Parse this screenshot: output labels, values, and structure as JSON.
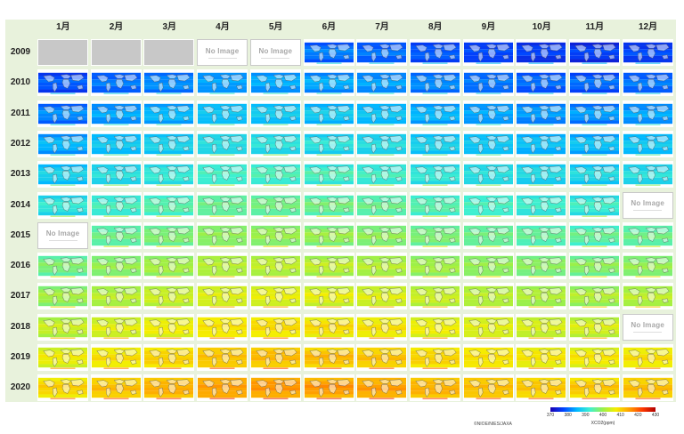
{
  "months": [
    "1月",
    "2月",
    "3月",
    "4月",
    "5月",
    "6月",
    "7月",
    "8月",
    "9月",
    "10月",
    "11月",
    "12月"
  ],
  "years": [
    "2009",
    "2010",
    "2011",
    "2012",
    "2013",
    "2014",
    "2015",
    "2016",
    "2017",
    "2018",
    "2019",
    "2020"
  ],
  "no_image_label": "No Image",
  "cells": {
    "2009-1": "nodata",
    "2009-2": "nodata",
    "2009-3": "nodata",
    "2009-4": "noimage",
    "2009-5": "noimage",
    "2014-12": "noimage",
    "2015-1": "noimage",
    "2018-12": "noimage"
  },
  "credit": "©NIOE/NIES/JAXA",
  "colorbar": {
    "ticks": [
      "370",
      "380",
      "390",
      "400",
      "410",
      "420",
      "430"
    ],
    "unit_label": "XCO2(ppm)",
    "colors": [
      "#1a00b0",
      "#0044ff",
      "#00b8ff",
      "#3ef0d0",
      "#9af04a",
      "#f5ee00",
      "#ffa000",
      "#ff3a00",
      "#b00000"
    ]
  },
  "colors": {
    "header_background": "#e8f2dc",
    "no_data_gray": "#c8c8c8"
  }
}
